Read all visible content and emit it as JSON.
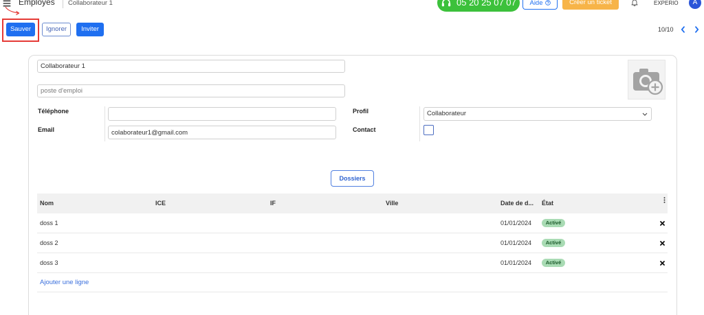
{
  "header": {
    "app_title": "Employés",
    "breadcrumb": "Collaborateur 1",
    "phone_number": "05 20 25 07 07",
    "help_label": "Aide",
    "create_ticket_label": "Créer un ticket",
    "company_name": "EXPERIO",
    "avatar_initial": "A"
  },
  "toolbar": {
    "save_label": "Sauver",
    "discard_label": "Ignorer",
    "invite_label": "Inviter",
    "pager": "10/10"
  },
  "form": {
    "name_value": "Collaborateur 1",
    "job_placeholder": "poste d'emploi",
    "phone_label": "Téléphone",
    "email_label": "Email",
    "email_value": "colaborateur1@gmail.com",
    "profile_label": "Profil",
    "profile_value": "Collaborateur",
    "contact_label": "Contact",
    "contact_checked": false
  },
  "dossiers": {
    "button_label": "Dossiers",
    "columns": [
      "Nom",
      "ICE",
      "IF",
      "Ville",
      "Date de d...",
      "État"
    ],
    "rows": [
      {
        "nom": "doss 1",
        "date": "01/01/2024",
        "etat": "Activé"
      },
      {
        "nom": "doss 2",
        "date": "01/01/2024",
        "etat": "Activé"
      },
      {
        "nom": "doss 3",
        "date": "01/01/2024",
        "etat": "Activé"
      }
    ],
    "add_line_label": "Ajouter une ligne"
  },
  "icons": {
    "menu": "hamburger-menu-icon",
    "phone": "headset-icon",
    "help": "help-circle-icon",
    "notifications": "bell-icon",
    "pager_prev": "chevron-left-icon",
    "pager_next": "chevron-right-icon",
    "photo": "camera-add-icon",
    "select": "chevron-down-icon",
    "column_options": "kebab-menu-icon",
    "row_delete": "delete-x-icon"
  },
  "colors": {
    "primary": "#1f6ff0",
    "phone_pill": "#3cc13b",
    "ticket": "#f7b448",
    "avatar": "#2b55d8",
    "badge_bg": "#a9dbb4",
    "badge_text": "#1c5a2b",
    "link": "#3a6fdc",
    "annotation": "#e53935"
  }
}
